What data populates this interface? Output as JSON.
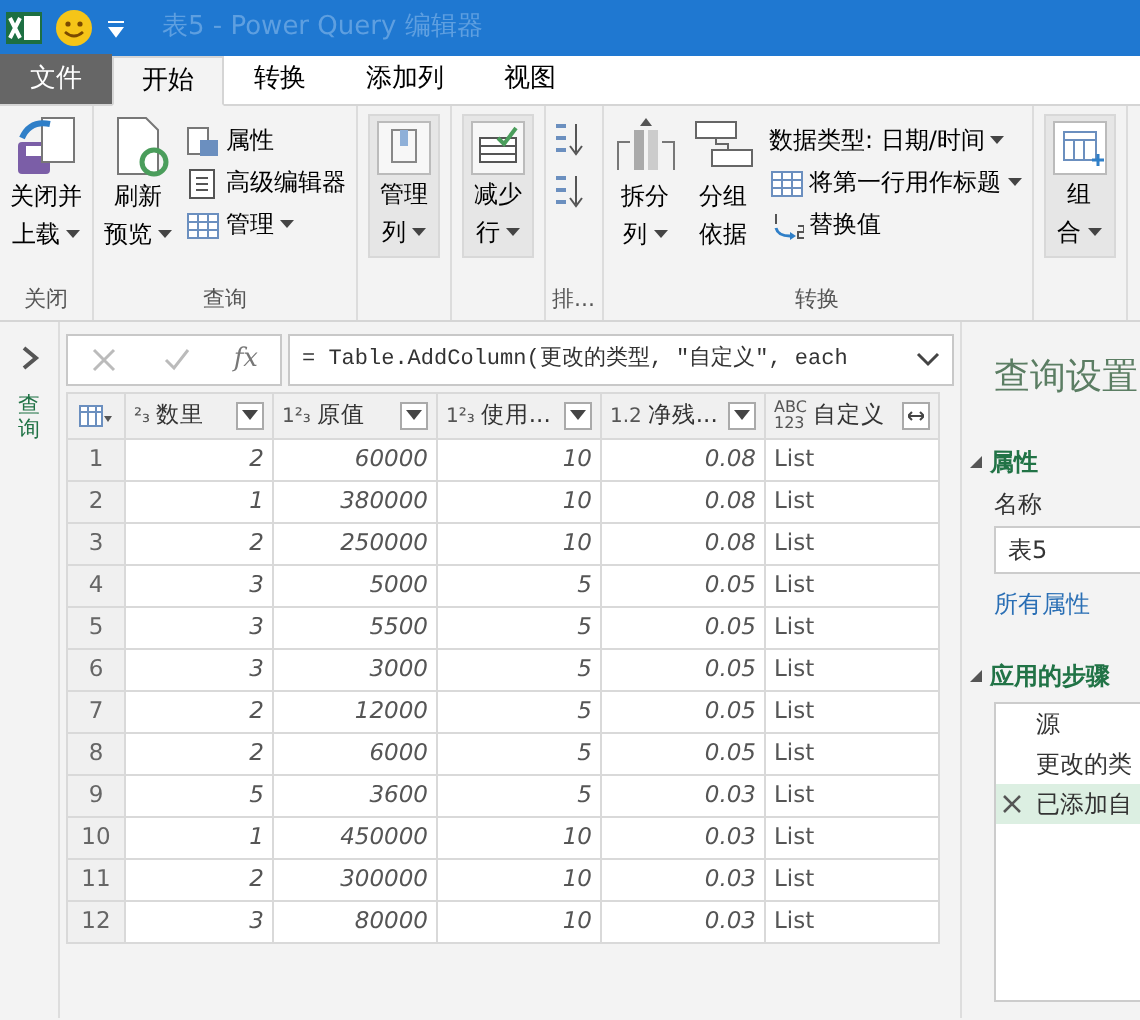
{
  "window": {
    "title": "表5 - Power Query 编辑器"
  },
  "tabs": [
    {
      "label": "文件",
      "kind": "file",
      "selected": false
    },
    {
      "label": "开始",
      "kind": "tab",
      "selected": true
    },
    {
      "label": "转换",
      "kind": "tab",
      "selected": false
    },
    {
      "label": "添加列",
      "kind": "tab",
      "selected": false
    },
    {
      "label": "视图",
      "kind": "tab",
      "selected": false
    }
  ],
  "ribbon": {
    "groups": [
      {
        "label": "关闭",
        "items": [
          {
            "kind": "large",
            "lines": [
              "关闭并",
              "上载"
            ],
            "dropdown": true
          }
        ]
      },
      {
        "label": "查询",
        "items": [
          {
            "kind": "large",
            "lines": [
              "刷新",
              "预览"
            ],
            "dropdown": true
          },
          {
            "kind": "stack",
            "items": [
              {
                "label": "属性",
                "dropdown": false
              },
              {
                "label": "高级编辑器",
                "dropdown": false
              },
              {
                "label": "管理",
                "dropdown": true
              }
            ]
          }
        ]
      },
      {
        "items": [
          {
            "kind": "panel",
            "lines": [
              "管理",
              "列"
            ],
            "dropdown": true
          }
        ]
      },
      {
        "items": [
          {
            "kind": "panel",
            "lines": [
              "减少",
              "行"
            ],
            "dropdown": true
          }
        ]
      },
      {
        "label": "排...",
        "items": [
          {
            "kind": "sort"
          }
        ]
      },
      {
        "label": "转换",
        "items": [
          {
            "kind": "large",
            "lines": [
              "拆分",
              "列"
            ],
            "dropdown": true
          },
          {
            "kind": "large",
            "lines": [
              "分组",
              "依据"
            ],
            "dropdown": false
          },
          {
            "kind": "stack",
            "items": [
              {
                "label": "数据类型: 日期/时间",
                "dropdown": true
              },
              {
                "label": "将第一行用作标题",
                "dropdown": true
              },
              {
                "label": "替换值",
                "dropdown": false
              }
            ]
          }
        ]
      },
      {
        "items": [
          {
            "kind": "panel",
            "lines": [
              "组",
              "合"
            ],
            "dropdown": true
          }
        ]
      }
    ]
  },
  "queries_pane": {
    "label": "查询"
  },
  "formula_bar": {
    "fx": "fx",
    "formula": "= Table.AddColumn(更改的类型, \"自定义\", each"
  },
  "table": {
    "columns": [
      {
        "type_label": [
          "²₃"
        ],
        "kind": "number",
        "name": "数里"
      },
      {
        "type_label": [
          "1²₃"
        ],
        "kind": "number",
        "name": "原值"
      },
      {
        "type_label": [
          "1²₃"
        ],
        "kind": "number",
        "name": "使用..."
      },
      {
        "type_label": [
          "1.2"
        ],
        "kind": "number",
        "name": "净残..."
      },
      {
        "type_label": [
          "ABC",
          "123"
        ],
        "kind": "text",
        "name": "自定义"
      }
    ],
    "rows": [
      {
        "index": "1",
        "cells": [
          "2",
          "60000",
          "10",
          "0.08",
          "List"
        ]
      },
      {
        "index": "2",
        "cells": [
          "1",
          "380000",
          "10",
          "0.08",
          "List"
        ]
      },
      {
        "index": "3",
        "cells": [
          "2",
          "250000",
          "10",
          "0.08",
          "List"
        ]
      },
      {
        "index": "4",
        "cells": [
          "3",
          "5000",
          "5",
          "0.05",
          "List"
        ]
      },
      {
        "index": "5",
        "cells": [
          "3",
          "5500",
          "5",
          "0.05",
          "List"
        ]
      },
      {
        "index": "6",
        "cells": [
          "3",
          "3000",
          "5",
          "0.05",
          "List"
        ]
      },
      {
        "index": "7",
        "cells": [
          "2",
          "12000",
          "5",
          "0.05",
          "List"
        ]
      },
      {
        "index": "8",
        "cells": [
          "2",
          "6000",
          "5",
          "0.05",
          "List"
        ]
      },
      {
        "index": "9",
        "cells": [
          "5",
          "3600",
          "5",
          "0.03",
          "List"
        ]
      },
      {
        "index": "10",
        "cells": [
          "1",
          "450000",
          "10",
          "0.03",
          "List"
        ]
      },
      {
        "index": "11",
        "cells": [
          "2",
          "300000",
          "10",
          "0.03",
          "List"
        ]
      },
      {
        "index": "12",
        "cells": [
          "3",
          "80000",
          "10",
          "0.03",
          "List"
        ]
      }
    ]
  },
  "settings": {
    "title": "查询设置",
    "properties": {
      "header": "属性",
      "name_label": "名称",
      "name_value": "表5",
      "all_link": "所有属性"
    },
    "steps": {
      "header": "应用的步骤",
      "items": [
        {
          "label": "源",
          "selected": false
        },
        {
          "label": "更改的类",
          "selected": false
        },
        {
          "label": "已添加自",
          "selected": true
        }
      ]
    }
  }
}
